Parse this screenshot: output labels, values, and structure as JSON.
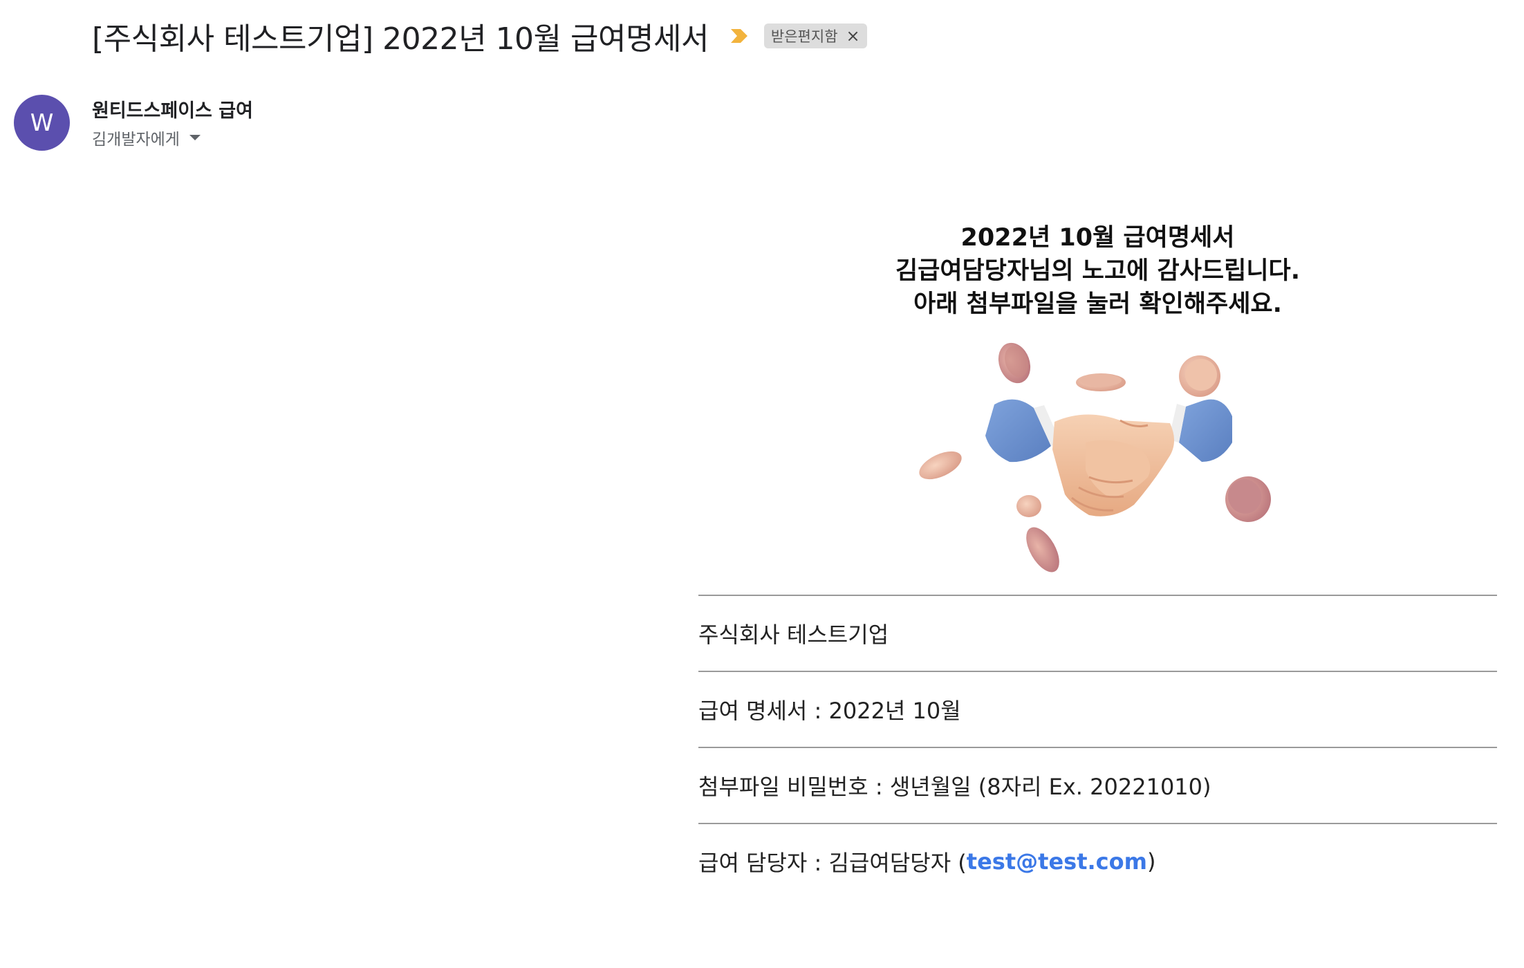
{
  "email": {
    "subject": "[주식회사 테스트기업] 2022년 10월 급여명세서",
    "label_chip": "받은편지함",
    "label_close": "×",
    "sender": {
      "avatar_letter": "W",
      "avatar_color": "#5b4fae",
      "name": "원티드스페이스 급여",
      "recipient_line": "김개발자에게"
    }
  },
  "body": {
    "heading_lines": [
      "2022년 10월 급여명세서",
      "김급여담당자님의 노고에 감사드립니다.",
      "아래 첨부파일을 눌러 확인해주세요."
    ],
    "company": "주식회사 테스트기업",
    "statement_line": "급여 명세서 : 2022년 10월",
    "password_line": "첨부파일 비밀번호 : 생년월일 (8자리 Ex. 20221010)",
    "contact": {
      "prefix": "급여 담당자 : 김급여담당자 (",
      "email": "test@test.com",
      "suffix": ")"
    }
  },
  "colors": {
    "link": "#3b78e7",
    "importance_marker": "#f2b33d",
    "chip_bg": "#dddddd"
  }
}
